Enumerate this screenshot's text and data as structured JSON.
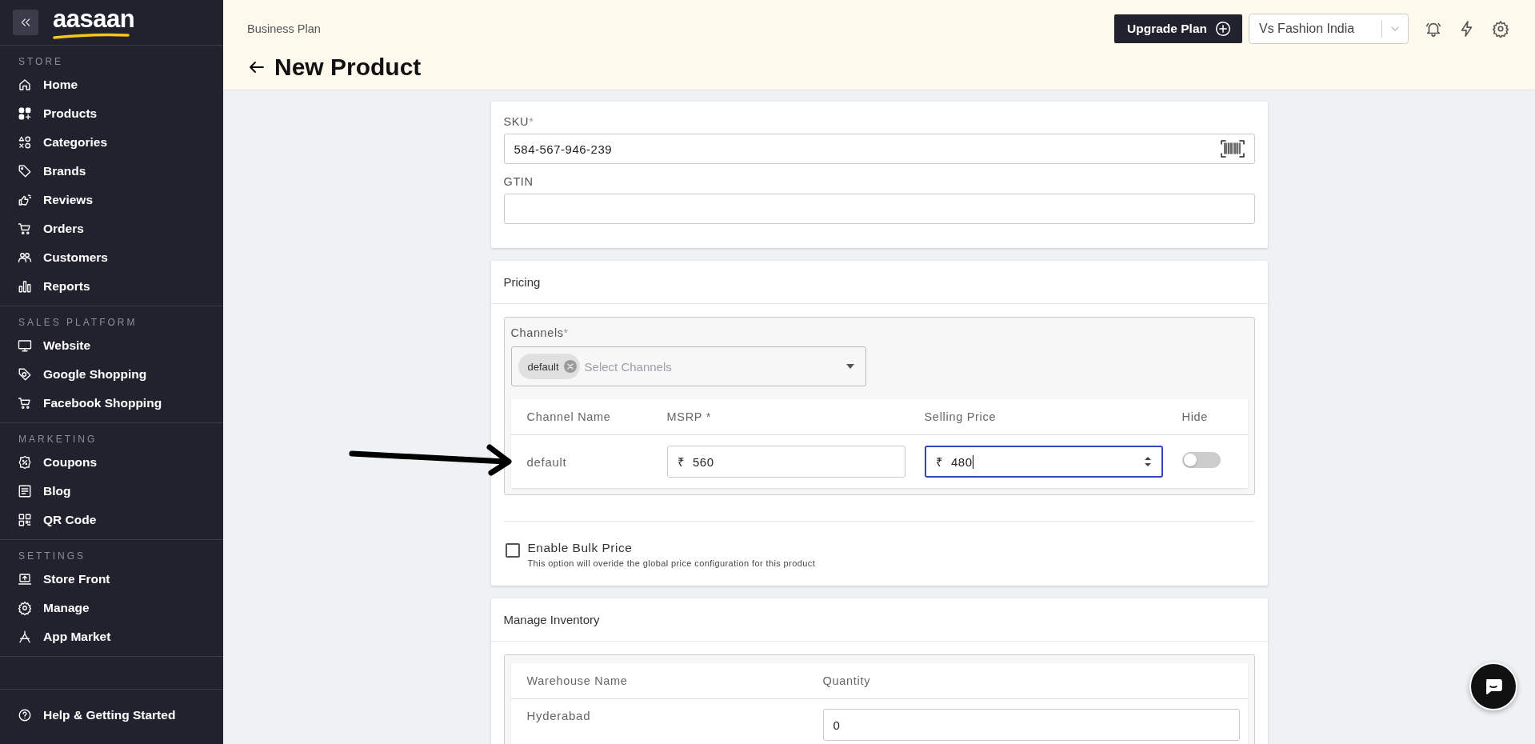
{
  "sidebar": {
    "logo": "aasaan",
    "sections": [
      {
        "title": "STORE",
        "items": [
          {
            "label": "Home"
          },
          {
            "label": "Products"
          },
          {
            "label": "Categories"
          },
          {
            "label": "Brands"
          },
          {
            "label": "Reviews"
          },
          {
            "label": "Orders"
          },
          {
            "label": "Customers"
          },
          {
            "label": "Reports"
          }
        ]
      },
      {
        "title": "SALES PLATFORM",
        "items": [
          {
            "label": "Website"
          },
          {
            "label": "Google Shopping"
          },
          {
            "label": "Facebook Shopping"
          }
        ]
      },
      {
        "title": "MARKETING",
        "items": [
          {
            "label": "Coupons"
          },
          {
            "label": "Blog"
          },
          {
            "label": "QR Code"
          }
        ]
      },
      {
        "title": "SETTINGS",
        "items": [
          {
            "label": "Store Front"
          },
          {
            "label": "Manage"
          },
          {
            "label": "App Market"
          }
        ]
      }
    ],
    "footer_item": {
      "label": "Help & Getting Started"
    }
  },
  "header": {
    "breadcrumb": "Business Plan",
    "title": "New Product",
    "upgrade_button": "Upgrade Plan",
    "store_select": "Vs Fashion India"
  },
  "identity": {
    "sku": {
      "label": "SKU",
      "required_mark": "*",
      "value": "584-567-946-239"
    },
    "gtin": {
      "label": "GTIN"
    }
  },
  "pricing": {
    "title": "Pricing",
    "channels": {
      "label": "Channels",
      "required_mark": "*",
      "chips": [
        "default"
      ],
      "placeholder": "Select Channels"
    },
    "table": {
      "columns": [
        "Channel Name",
        "MSRP *",
        "Selling Price",
        "Hide"
      ],
      "rows": [
        {
          "channel": "default",
          "msrp_currency": "₹",
          "msrp": "560",
          "selling_currency": "₹",
          "selling_price": "480",
          "selling_focused": true,
          "hide": false
        }
      ]
    },
    "bulk_price": {
      "label": "Enable Bulk Price",
      "checked": false,
      "help": "This option will overide the global price configuration for this product"
    }
  },
  "inventory": {
    "title": "Manage Inventory",
    "table": {
      "columns": [
        "Warehouse Name",
        "Quantity"
      ],
      "rows": [
        {
          "warehouse": "Hyderabad",
          "quantity": "0"
        }
      ]
    }
  }
}
